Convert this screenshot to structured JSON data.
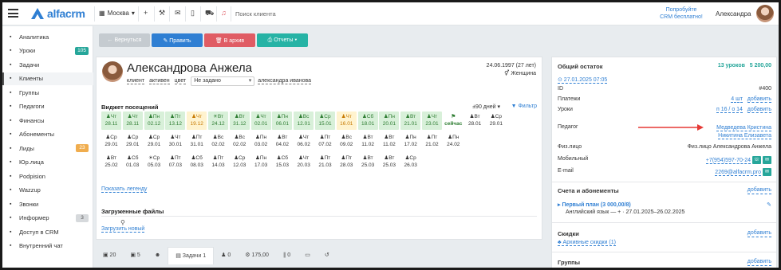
{
  "topbar": {
    "logo": "alfacrm",
    "branch": "Москва",
    "search_placeholder": "Поиск клиента",
    "promo_line1": "Попробуйте",
    "promo_line2": "CRM бесплатно!",
    "user": "Александра"
  },
  "sidebar": {
    "items": [
      {
        "label": "Аналитика",
        "icon": "chart-icon"
      },
      {
        "label": "Уроки",
        "icon": "calendar-icon",
        "badge": "105",
        "badge_color": "#26a69a"
      },
      {
        "label": "Задачи",
        "icon": "tasks-icon"
      },
      {
        "label": "Клиенты",
        "icon": "user-icon"
      },
      {
        "label": "Группы",
        "icon": "group-icon"
      },
      {
        "label": "Педагоги",
        "icon": "teacher-icon"
      },
      {
        "label": "Финансы",
        "icon": "finance-icon"
      },
      {
        "label": "Абонементы",
        "icon": "tag-icon"
      },
      {
        "label": "Лиды",
        "icon": "leads-icon",
        "badge": "23",
        "badge_color": "#f0ad4e"
      },
      {
        "label": "Юр.лица",
        "icon": "company-icon"
      },
      {
        "label": "Podpision",
        "icon": "doc-icon"
      },
      {
        "label": "Wazzup",
        "icon": "whatsapp-icon"
      },
      {
        "label": "Звонки",
        "icon": "phone-icon"
      },
      {
        "label": "Информер",
        "icon": "informer-icon",
        "badge": "3",
        "badge_color": "#d6d9dc"
      },
      {
        "label": "Доступ в CRM",
        "icon": "lock-icon"
      },
      {
        "label": "Внутренний чат",
        "icon": "chat-icon"
      }
    ]
  },
  "toolbar": {
    "back": "← Вернуться",
    "edit": "✎ Править",
    "archive": "🗑 В архив",
    "reports": "⎙ Отчеты ▾"
  },
  "client": {
    "name": "Александрова Анжела",
    "chip_client": "клиент",
    "chip_active": "активен",
    "chip_color": "цвет",
    "select_value": "Не задано",
    "manager": "александра иванова",
    "dob": "24.06.1997 (27 лет)",
    "gender": "⚥ Женщина"
  },
  "attendance": {
    "title": "Виджет посещений",
    "period": "±90 дней ▾",
    "filter": "▼ Фильтр",
    "legend_link": "Показать легенду",
    "cells": [
      {
        "w": "Чт",
        "d": "28.11",
        "s": "green",
        "i": "♟"
      },
      {
        "w": "Чт",
        "d": "28.11",
        "s": "green",
        "i": "♟"
      },
      {
        "w": "Пн",
        "d": "02.12",
        "s": "green",
        "i": "♟"
      },
      {
        "w": "Пт",
        "d": "13.12",
        "s": "green",
        "i": "♟"
      },
      {
        "w": "Чт",
        "d": "19.12",
        "s": "orange",
        "i": "♟"
      },
      {
        "w": "Вт",
        "d": "24.12",
        "s": "green",
        "i": "☀"
      },
      {
        "w": "Вт",
        "d": "31.12",
        "s": "green",
        "i": "♟"
      },
      {
        "w": "Чт",
        "d": "02.01",
        "s": "green",
        "i": "♟"
      },
      {
        "w": "Пн",
        "d": "06.01",
        "s": "green",
        "i": "♟"
      },
      {
        "w": "Вс",
        "d": "12.01",
        "s": "green",
        "i": "♟"
      },
      {
        "w": "Ср",
        "d": "15.01",
        "s": "green",
        "i": "♟"
      },
      {
        "w": "Чт",
        "d": "16.01",
        "s": "orange",
        "i": "♟"
      },
      {
        "w": "Сб",
        "d": "18.01",
        "s": "green",
        "i": "♟"
      },
      {
        "w": "Пн",
        "d": "20.01",
        "s": "green",
        "i": "♟"
      },
      {
        "w": "Вт",
        "d": "21.01",
        "s": "green",
        "i": "♟"
      },
      {
        "w": "Чт",
        "d": "23.01",
        "s": "green",
        "i": "♟"
      },
      {
        "w": "⚑",
        "d": "сейчас",
        "s": "now",
        "i": ""
      },
      {
        "w": "Вт",
        "d": "28.01",
        "s": "future",
        "i": "♟"
      },
      {
        "w": "Ср",
        "d": "29.01",
        "s": "future",
        "i": "♟"
      },
      {
        "w": "Ср",
        "d": "29.01",
        "s": "future",
        "i": "♟"
      },
      {
        "w": "Ср",
        "d": "29.01",
        "s": "future",
        "i": "♟"
      },
      {
        "w": "Ср",
        "d": "29.01",
        "s": "future",
        "i": "♟"
      },
      {
        "w": "Чт",
        "d": "30.01",
        "s": "future",
        "i": "♟"
      },
      {
        "w": "Пт",
        "d": "31.01",
        "s": "future",
        "i": "♟"
      },
      {
        "w": "Вс",
        "d": "02.02",
        "s": "future",
        "i": "♟"
      },
      {
        "w": "Вс",
        "d": "02.02",
        "s": "future",
        "i": "♟"
      },
      {
        "w": "Пн",
        "d": "03.02",
        "s": "future",
        "i": "♟"
      },
      {
        "w": "Вт",
        "d": "04.02",
        "s": "future",
        "i": "♟"
      },
      {
        "w": "Чт",
        "d": "06.02",
        "s": "future",
        "i": "♟"
      },
      {
        "w": "Пт",
        "d": "07.02",
        "s": "future",
        "i": "♟"
      },
      {
        "w": "Вс",
        "d": "09.02",
        "s": "future",
        "i": "♟"
      },
      {
        "w": "Вт",
        "d": "11.02",
        "s": "future",
        "i": "♟"
      },
      {
        "w": "Вт",
        "d": "11.02",
        "s": "future",
        "i": "♟"
      },
      {
        "w": "Пн",
        "d": "17.02",
        "s": "future",
        "i": "♟"
      },
      {
        "w": "Пт",
        "d": "21.02",
        "s": "future",
        "i": "♟"
      },
      {
        "w": "Пн",
        "d": "24.02",
        "s": "future",
        "i": "♟"
      },
      {
        "w": "Вт",
        "d": "25.02",
        "s": "future",
        "i": "♟"
      },
      {
        "w": "Сб",
        "d": "01.03",
        "s": "future",
        "i": "♟"
      },
      {
        "w": "Ср",
        "d": "05.03",
        "s": "future",
        "i": "☀"
      },
      {
        "w": "Пт",
        "d": "07.03",
        "s": "future",
        "i": "♟"
      },
      {
        "w": "Сб",
        "d": "08.03",
        "s": "future",
        "i": "♟"
      },
      {
        "w": "Пт",
        "d": "14.03",
        "s": "future",
        "i": "♟"
      },
      {
        "w": "Ср",
        "d": "12.03",
        "s": "future",
        "i": "♟"
      },
      {
        "w": "Пн",
        "d": "17.03",
        "s": "future",
        "i": "♟"
      },
      {
        "w": "Сб",
        "d": "15.03",
        "s": "future",
        "i": "♟"
      },
      {
        "w": "Чт",
        "d": "20.03",
        "s": "future",
        "i": "♟"
      },
      {
        "w": "Пт",
        "d": "21.03",
        "s": "future",
        "i": "♟"
      },
      {
        "w": "Пт",
        "d": "28.03",
        "s": "future",
        "i": "♟"
      },
      {
        "w": "Вт",
        "d": "25.03",
        "s": "future",
        "i": "♟"
      },
      {
        "w": "Вт",
        "d": "25.03",
        "s": "future",
        "i": "♟"
      },
      {
        "w": "Ср",
        "d": "26.03",
        "s": "future",
        "i": "♟"
      }
    ]
  },
  "files": {
    "title": "Загруженные файлы",
    "upload": "Загрузить новый"
  },
  "tabs": [
    "▣ 20",
    "▣ 5",
    "☻",
    "▤ Задачи 1",
    "♟ 0",
    "⚙ 175,00",
    "∥ 0",
    "▭",
    "↺"
  ],
  "right": {
    "balance_label": "Общий остаток",
    "balance_lessons": "13 уроков",
    "balance_sum": "5 200,00",
    "date_link": "⊙ 27.01.2025 07:05",
    "id_label": "ID",
    "id_value": "#400",
    "payments_label": "Платежи",
    "payments_value": "4 шт",
    "payments_add": "добавить",
    "lessons_label": "Уроки",
    "lessons_value": "п 16 / о 14",
    "lessons_add": "добавить",
    "teacher_label": "Педагог",
    "teacher_1": "Медведева Кристина",
    "teacher_2": "Никитина Елизавета",
    "person_label": "Физ.лицо",
    "person_value": "Физ.лицо Александрова Анжела",
    "mobile_label": "Мобильный",
    "mobile_value": "+7(954)597-70-24",
    "email_label": "E-mail",
    "email_value": "2269@alfacrm.pro",
    "accounts_title": "Счета и абонементы",
    "accounts_add": "добавить",
    "plan_title": "▸ Первый план (3 000,00/8)",
    "plan_detail": "Английский язык — + · 27.01.2025–26.02.2025",
    "discounts_title": "Скидки",
    "discounts_add": "добавить",
    "discounts_archive": "♣ Архивные скидки (1)",
    "groups_title": "Группы",
    "groups_add": "добавить"
  },
  "colors": {
    "accent": "#2f7fd3",
    "green": "#26a69a",
    "red": "#e05c64",
    "arrow": "#e53935"
  }
}
